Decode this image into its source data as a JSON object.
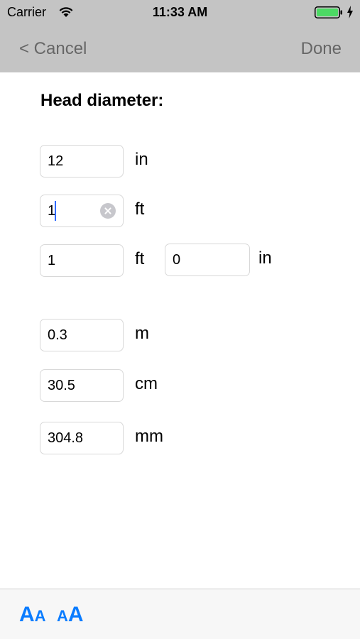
{
  "status_bar": {
    "carrier": "Carrier",
    "time": "11:33 AM",
    "battery_color": "#4cd964"
  },
  "nav": {
    "cancel_label": "< Cancel",
    "done_label": "Done"
  },
  "form": {
    "title": "Head diameter:",
    "inches": {
      "value": "12",
      "unit": "in"
    },
    "feet": {
      "value": "1",
      "unit": "ft"
    },
    "feet_inches": {
      "feet_value": "1",
      "feet_unit": "ft",
      "inches_value": "0",
      "inches_unit": "in"
    },
    "meters": {
      "value": "0.3",
      "unit": "m"
    },
    "centimeters": {
      "value": "30.5",
      "unit": "cm"
    },
    "millimeters": {
      "value": "304.8",
      "unit": "mm"
    }
  },
  "toolbar": {
    "smaller_text_big": "A",
    "smaller_text_small": "A",
    "larger_text_small": "A",
    "larger_text_big": "A",
    "accent_color": "#0a7cff"
  }
}
